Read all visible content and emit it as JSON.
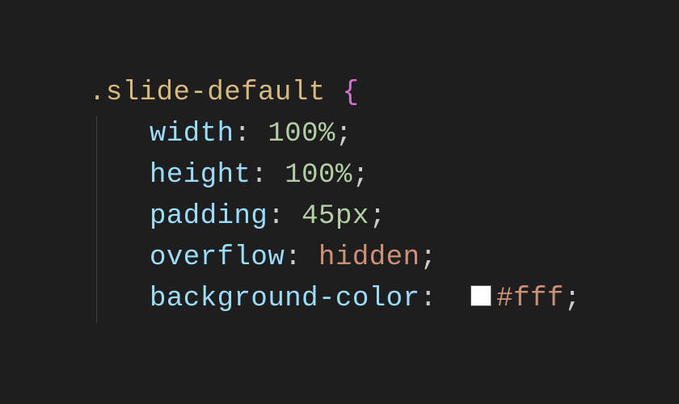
{
  "code": {
    "selector": ".slide-default",
    "open_brace": " {",
    "rules": [
      {
        "prop": "width",
        "value": "100%",
        "value_type": "num"
      },
      {
        "prop": "height",
        "value": "100%",
        "value_type": "num"
      },
      {
        "prop": "padding",
        "value": "45px",
        "value_type": "num"
      },
      {
        "prop": "overflow",
        "value": "hidden",
        "value_type": "kw"
      },
      {
        "prop": "background-color",
        "value": "#fff",
        "value_type": "hex",
        "swatch": "#ffffff"
      }
    ],
    "colon": ":",
    "semi": ";"
  }
}
